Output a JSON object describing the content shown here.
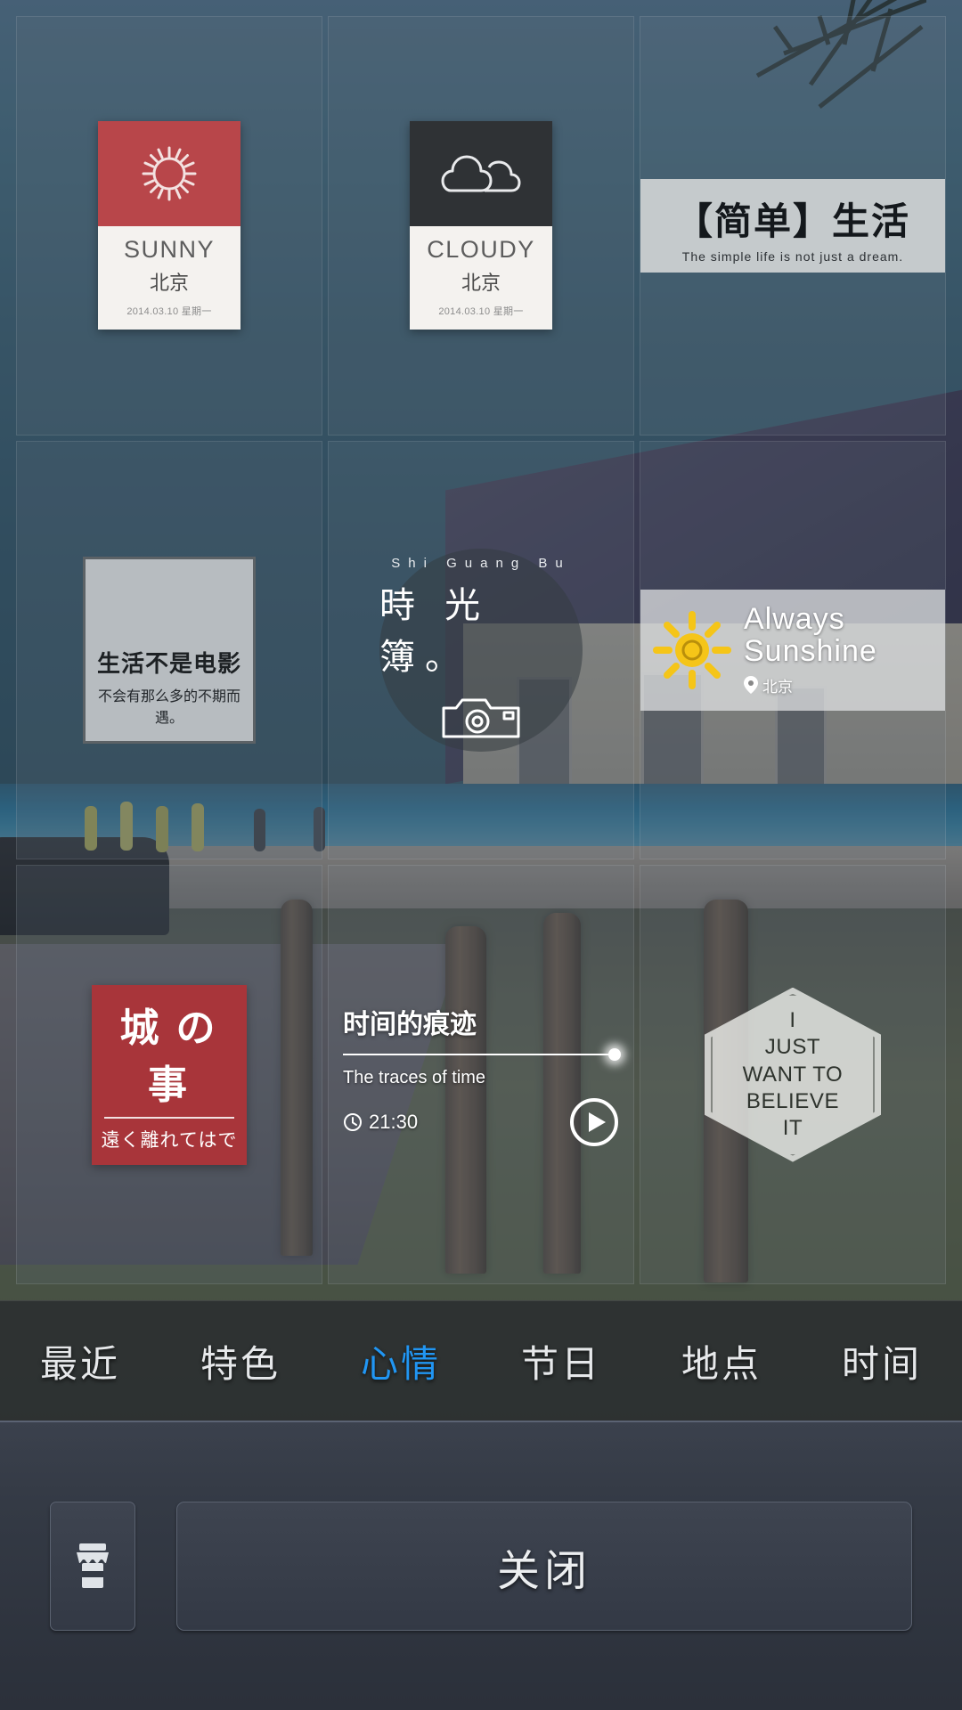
{
  "stickers": [
    {
      "id": "sunny-weather-card",
      "title": "SUNNY",
      "city": "北京",
      "date": "2014.03.10  星期一",
      "icon": "sun-icon",
      "accent": "#b8464a"
    },
    {
      "id": "cloudy-weather-card",
      "title": "CLOUDY",
      "city": "北京",
      "date": "2014.03.10  星期一",
      "icon": "cloud-icon",
      "accent": "#2f3235"
    },
    {
      "id": "simple-life-card",
      "zh": "【简单】生活",
      "en": "The simple life is not just a dream."
    },
    {
      "id": "movie-quote-card",
      "line1": "生活不是电影",
      "line2": "不会有那么多的不期而遇。"
    },
    {
      "id": "shi-guang-bu-card",
      "pinyin": "Shi  Guang  Bu",
      "zh": "時 光 簿。",
      "icon": "camera-icon"
    },
    {
      "id": "always-sunshine-card",
      "line1": "Always",
      "line2": "Sunshine",
      "location": "北京",
      "icon": "hand-drawn-sun-icon",
      "pin": "location-pin-icon"
    },
    {
      "id": "city-story-card",
      "line1": "城 の 事",
      "line2": "遠く離れてはで",
      "accent": "#a8353a"
    },
    {
      "id": "traces-of-time-card",
      "title": "时间的痕迹",
      "subtitle": "The traces of time",
      "time": "21:30",
      "clock_icon": "clock-icon",
      "play_icon": "play-icon"
    },
    {
      "id": "believe-hexagon-card",
      "lines": [
        "I",
        "JUST",
        "WANT TO",
        "BELIEVE",
        "IT"
      ]
    }
  ],
  "tabs": [
    {
      "label": "最近",
      "active": false
    },
    {
      "label": "特色",
      "active": false
    },
    {
      "label": "心情",
      "active": true
    },
    {
      "label": "节日",
      "active": false
    },
    {
      "label": "地点",
      "active": false
    },
    {
      "label": "时间",
      "active": false
    }
  ],
  "actionbar": {
    "store_icon": "store-icon",
    "close_label": "关闭"
  },
  "colors": {
    "accent_active_tab": "#2196f3",
    "sunny_red": "#b8464a",
    "cloudy_dark": "#2f3235",
    "city_red": "#a8353a"
  }
}
